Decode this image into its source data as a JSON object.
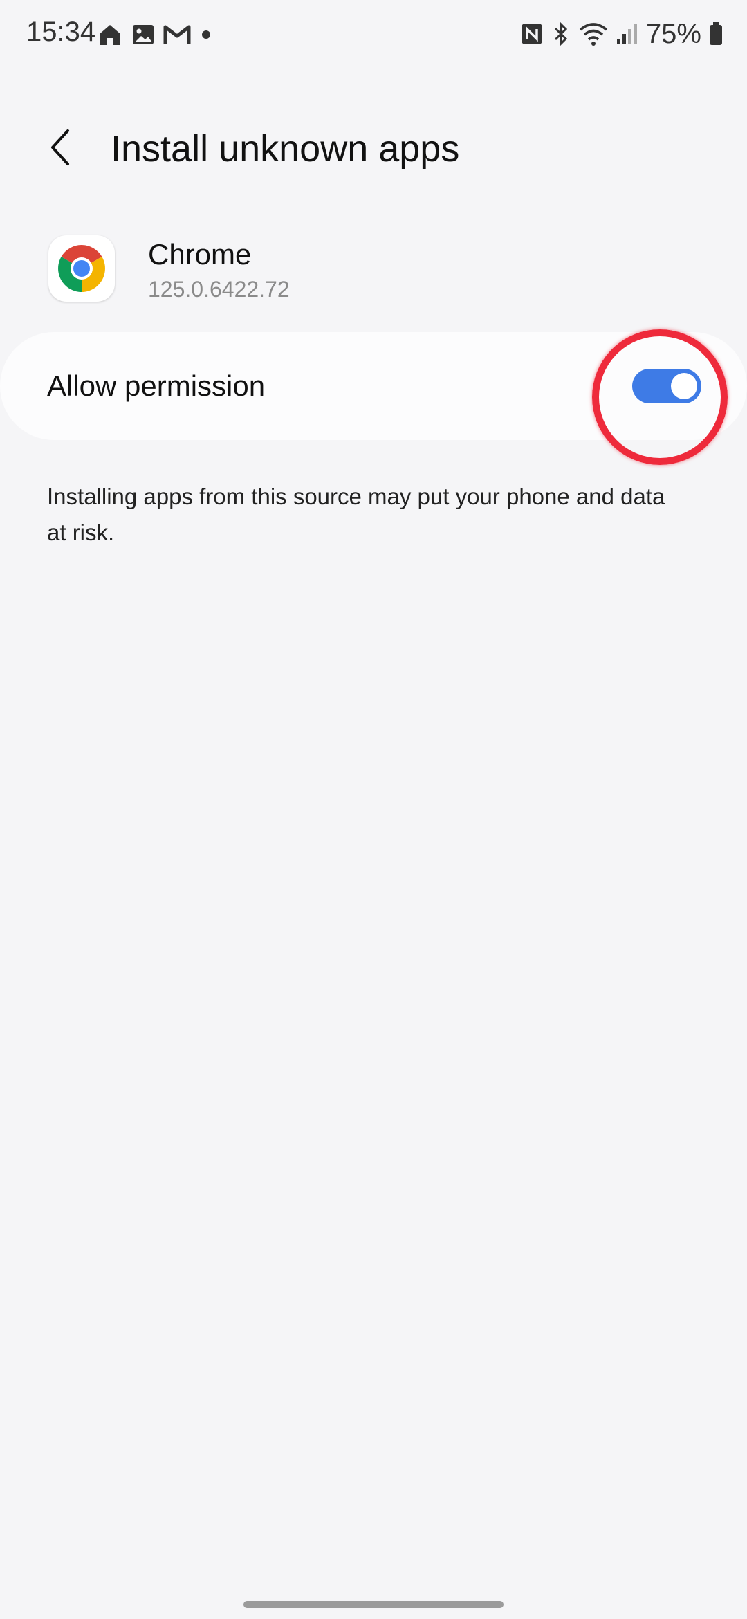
{
  "status_bar": {
    "time": "15:34",
    "left_icons": [
      "house-icon",
      "image-icon",
      "gmail-icon",
      "dot-icon"
    ],
    "right_icons": [
      "nfc-icon",
      "bluetooth-icon",
      "wifi-icon",
      "signal-icon",
      "battery-icon"
    ],
    "battery_text": "75%"
  },
  "header": {
    "title": "Install unknown apps",
    "back_icon": "chevron-left-icon"
  },
  "app": {
    "name": "Chrome",
    "version": "125.0.6422.72",
    "icon": "chrome-icon"
  },
  "permission": {
    "label": "Allow permission",
    "enabled": true
  },
  "warning": {
    "text": "Installing apps from this source may put your phone and data at risk."
  },
  "colors": {
    "background": "#f5f5f7",
    "toggle_on": "#3e7be6",
    "highlight": "#ee2a3b"
  }
}
